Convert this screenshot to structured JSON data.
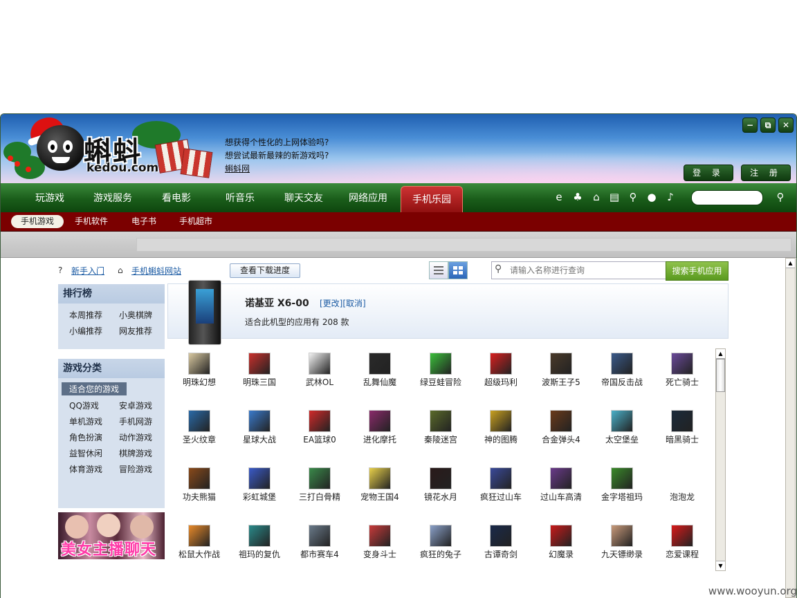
{
  "banner": {
    "logo_cn": "蝌蚪",
    "logo_en": "kedou.com",
    "promo_line1": "想获得个性化的上网体验吗?",
    "promo_line2": "想尝试最新最辣的新游戏吗?",
    "promo_link": "蝌蚪网",
    "login_label": "登 录",
    "register_label": "注 册"
  },
  "window_controls": {
    "minimize": "−",
    "restore": "⧉",
    "close": "✕"
  },
  "nav": {
    "items": [
      "玩游戏",
      "游戏服务",
      "看电影",
      "听音乐",
      "聊天交友",
      "网络应用",
      "手机乐园"
    ],
    "active": "手机乐园",
    "tool_icons": [
      "ie-icon",
      "qq-icon",
      "lock-icon",
      "save-icon",
      "search-icon",
      "chat-icon",
      "mic-icon"
    ]
  },
  "subnav": {
    "items": [
      "手机游戏",
      "手机软件",
      "电子书",
      "手机超市"
    ],
    "active": "手机游戏"
  },
  "toolbar": {
    "newbie_link": "新手入门",
    "mobile_site_link": "手机蝌蚪网站",
    "download_progress_button": "查看下载进度",
    "search_placeholder": "请输入名称进行查询",
    "search_button": "搜索手机应用"
  },
  "sidebar": {
    "ranking": {
      "title": "排行榜",
      "items": [
        "本周推荐",
        "小奥棋牌",
        "小编推荐",
        "网友推荐"
      ]
    },
    "categories": {
      "title": "游戏分类",
      "selected": "适合您的游戏",
      "items": [
        "QQ游戏",
        "安卓游戏",
        "单机游戏",
        "手机网游",
        "角色扮演",
        "动作游戏",
        "益智休闲",
        "棋牌游戏",
        "体育游戏",
        "冒险游戏"
      ]
    },
    "ad_text": "美女主播聊天"
  },
  "device": {
    "name": "诺基亚 X6-00",
    "actions": "[更改][取消]",
    "app_count_text": "适合此机型的应用有 208 款"
  },
  "apps": [
    {
      "name": "明珠幻想",
      "color": "#d8c8a0"
    },
    {
      "name": "明珠三国",
      "color": "#c9302c"
    },
    {
      "name": "武林OL",
      "color": "#f2f2f2"
    },
    {
      "name": "乱舞仙魔",
      "color": "#2a2a2a"
    },
    {
      "name": "绿豆蛙冒险",
      "color": "#3bbf3b"
    },
    {
      "name": "超级玛利",
      "color": "#d82020"
    },
    {
      "name": "波斯王子5",
      "color": "#4a3a2a"
    },
    {
      "name": "帝国反击战",
      "color": "#3a5a8a"
    },
    {
      "name": "死亡骑士",
      "color": "#6a4a9a"
    },
    {
      "name": "圣火纹章",
      "color": "#2a6aa8"
    },
    {
      "name": "星球大战",
      "color": "#3a7acb"
    },
    {
      "name": "EA篮球0",
      "color": "#d02a2a"
    },
    {
      "name": "进化摩托",
      "color": "#8a2a6a"
    },
    {
      "name": "秦陵迷宫",
      "color": "#5a6a2a"
    },
    {
      "name": "神的图腾",
      "color": "#c8a020"
    },
    {
      "name": "合金弹头4",
      "color": "#6a3a1a"
    },
    {
      "name": "太空堡垒",
      "color": "#4ab0c8"
    },
    {
      "name": "暗黑骑士",
      "color": "#1a2a3a"
    },
    {
      "name": "功夫熊猫",
      "color": "#8a4a1a"
    },
    {
      "name": "彩虹城堡",
      "color": "#3a5ac8"
    },
    {
      "name": "三打白骨精",
      "color": "#3a8a4a"
    },
    {
      "name": "宠物王国4",
      "color": "#e8d04a"
    },
    {
      "name": "镜花水月",
      "color": "#2a1a1a"
    },
    {
      "name": "疯狂过山车",
      "color": "#3a4a9a"
    },
    {
      "name": "过山车高清",
      "color": "#6a3a8a"
    },
    {
      "name": "金字塔祖玛",
      "color": "#3a8a2a"
    },
    {
      "name": "泡泡龙",
      "color": "#ffffff"
    },
    {
      "name": "松鼠大作战",
      "color": "#e88a2a"
    },
    {
      "name": "祖玛的复仇",
      "color": "#2a8a8a"
    },
    {
      "name": "都市赛车4",
      "color": "#6a7a8a"
    },
    {
      "name": "变身斗士",
      "color": "#c83a3a"
    },
    {
      "name": "疯狂的兔子",
      "color": "#8aa0c8"
    },
    {
      "name": "古谭奇剑",
      "color": "#1a2a4a"
    },
    {
      "name": "幻魔录",
      "color": "#c81a1a"
    },
    {
      "name": "九天镖缈录",
      "color": "#c89a7a"
    },
    {
      "name": "恋爱课程",
      "color": "#d81a1a"
    }
  ],
  "watermark": "www.wooyun.org"
}
